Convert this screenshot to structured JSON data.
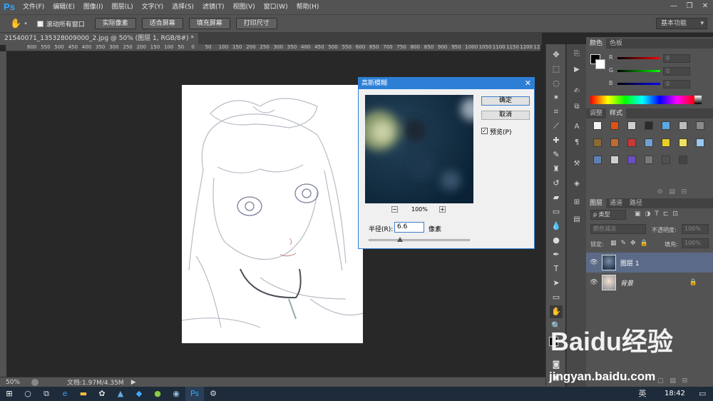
{
  "app": {
    "logo": "Ps",
    "window_buttons": [
      "—",
      "❐",
      "✕"
    ]
  },
  "menus": [
    "文件(F)",
    "编辑(E)",
    "图像(I)",
    "图层(L)",
    "文字(Y)",
    "选择(S)",
    "滤镜(T)",
    "视图(V)",
    "窗口(W)",
    "帮助(H)"
  ],
  "options": {
    "scroll_all_label": "滚动所有窗口",
    "buttons": [
      "实际像素",
      "适合屏幕",
      "填充屏幕",
      "打印尺寸"
    ],
    "workspace": "基本功能"
  },
  "doc_tab": "21540071_135328009000_2.jpg @ 50% (图层 1, RGB/8#) *",
  "ruler_h": [
    "600",
    "550",
    "500",
    "450",
    "400",
    "350",
    "300",
    "250",
    "200",
    "150",
    "100",
    "50",
    "0",
    "50",
    "100",
    "150",
    "200",
    "250",
    "300",
    "350",
    "400",
    "450",
    "500",
    "550",
    "600",
    "650",
    "700",
    "750",
    "800",
    "850",
    "900",
    "950",
    "1000",
    "1050",
    "1100",
    "1150",
    "1200",
    "1250",
    "1300"
  ],
  "status": {
    "zoom": "50%",
    "doc": "文档:1.97M/4.35M"
  },
  "color_panel": {
    "tabs": [
      "颜色",
      "色板"
    ],
    "channels": [
      {
        "label": "R",
        "value": "0"
      },
      {
        "label": "G",
        "value": "0"
      },
      {
        "label": "B",
        "value": "0"
      }
    ]
  },
  "styles_panel": {
    "tabs": [
      "调整",
      "样式"
    ]
  },
  "layers_panel": {
    "tabs": [
      "图层",
      "通道",
      "路径"
    ],
    "kind": "ρ 类型",
    "blend_mode": "颜色减淡",
    "opacity_label": "不透明度:",
    "opacity_value": "100%",
    "lock_label": "锁定:",
    "fill_label": "填充:",
    "fill_value": "100%",
    "layers": [
      {
        "name": "图层 1",
        "selected": true
      },
      {
        "name": "背景",
        "selected": false
      }
    ]
  },
  "dialog": {
    "title": "高斯模糊",
    "ok": "确定",
    "cancel": "取消",
    "preview_label": "预览(P)",
    "preview_checked": true,
    "zoom": "100%",
    "zoom_minus": "−",
    "zoom_plus": "+",
    "radius_label": "半径(R):",
    "radius_value": "6.6",
    "radius_unit": "像素",
    "close": "✕"
  },
  "watermark": {
    "text": "Baidu经验",
    "url": "jingyan.baidu.com"
  },
  "taskbar": {
    "time": "18:42",
    "ime": "英"
  },
  "colors": {
    "accent": "#2d7fd6",
    "panel": "#535353",
    "canvas_bg": "#282828"
  }
}
